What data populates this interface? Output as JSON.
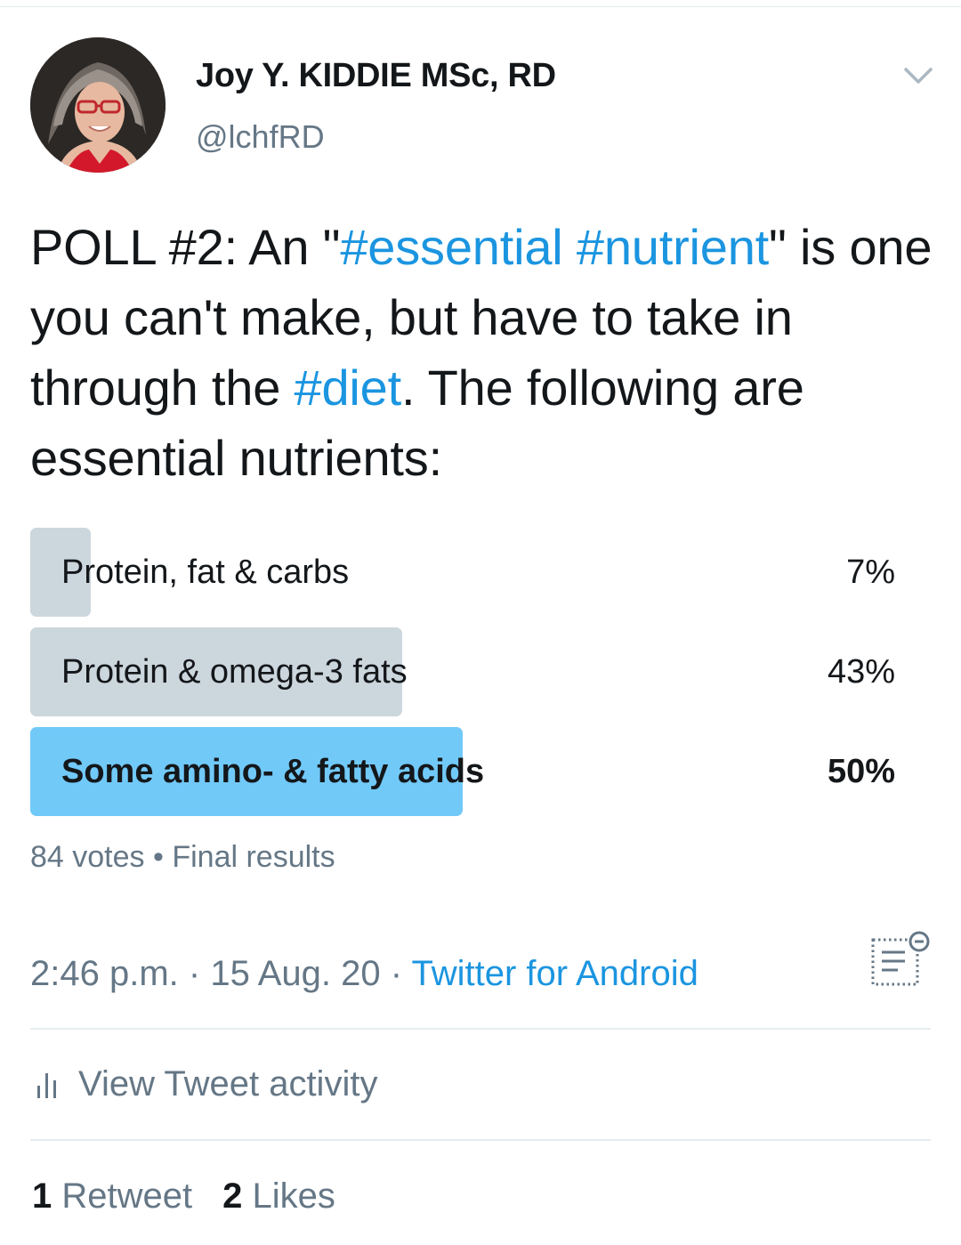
{
  "author": {
    "display_name": "Joy Y. KIDDIE MSc, RD",
    "handle": "@lchfRD"
  },
  "tweet": {
    "segments": [
      {
        "text": "POLL #2: An \"",
        "hashtag": false
      },
      {
        "text": "#essential",
        "hashtag": true
      },
      {
        "text": " ",
        "hashtag": false
      },
      {
        "text": "#nutrient",
        "hashtag": true
      },
      {
        "text": "\" is one you can't make, but have to take in through the ",
        "hashtag": false
      },
      {
        "text": "#diet",
        "hashtag": true
      },
      {
        "text": ". The following are essential nutrients:",
        "hashtag": false
      }
    ]
  },
  "poll": {
    "options": [
      {
        "label": "Protein, fat & carbs",
        "percent_text": "7%",
        "percent": 7,
        "winner": false
      },
      {
        "label": "Protein & omega-3 fats",
        "percent_text": "43%",
        "percent": 43,
        "winner": false
      },
      {
        "label": "Some amino- & fatty acids",
        "percent_text": "50%",
        "percent": 50,
        "winner": true
      }
    ],
    "votes": "84 votes",
    "separator": "•",
    "status": "Final results"
  },
  "meta": {
    "time": "2:46 p.m.",
    "date": "15 Aug. 20",
    "dot": "·",
    "source": "Twitter for Android"
  },
  "activity": {
    "label": "View Tweet activity"
  },
  "stats": {
    "retweets_count": "1",
    "retweets_label": "Retweet",
    "likes_count": "2",
    "likes_label": "Likes"
  },
  "colors": {
    "link": "#1b95e0",
    "muted": "#657786",
    "poll_bar": "#ccd6dd",
    "poll_winner": "#71c9f8"
  },
  "icons": {
    "menu": "chevron-down-icon",
    "activity": "tweet-activity-icon",
    "analytics": "bar-chart-icon"
  }
}
